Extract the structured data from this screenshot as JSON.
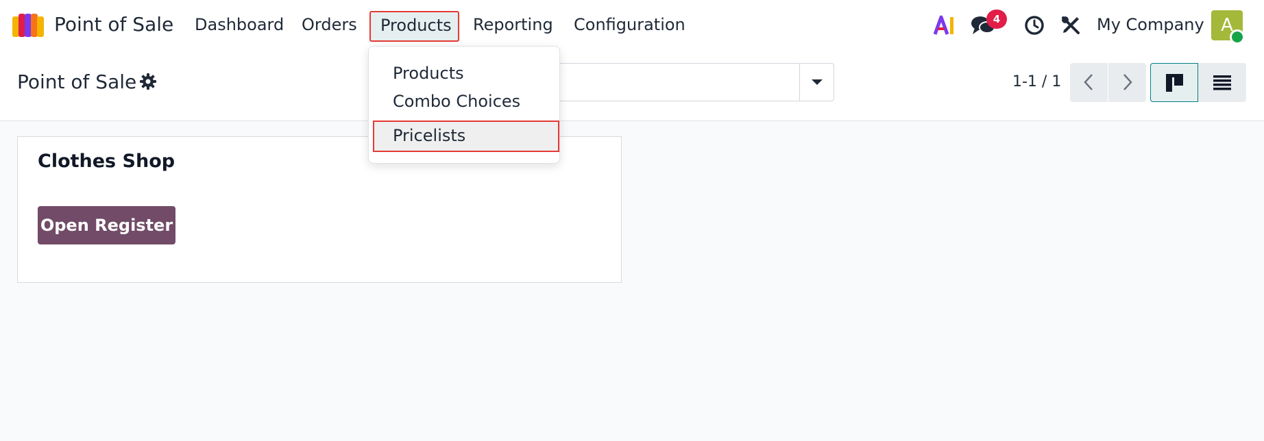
{
  "navbar": {
    "app_name": "Point of Sale",
    "menu": {
      "dashboard": "Dashboard",
      "orders": "Orders",
      "products": "Products",
      "reporting": "Reporting",
      "configuration": "Configuration"
    },
    "ai_icon": "ai-icon",
    "messages_badge": "4",
    "company": "My Company",
    "avatar_letter": "A"
  },
  "dropdown": {
    "items": [
      "Products",
      "Combo Choices",
      "Pricelists"
    ],
    "highlighted": "Pricelists"
  },
  "control_panel": {
    "title": "Point of Sale",
    "pager": "1-1 / 1"
  },
  "card": {
    "title": "Clothes Shop",
    "button_label": "Open Register"
  },
  "colors": {
    "brand": "#714b67",
    "accent": "#017e84",
    "badge": "#e11d48",
    "highlight_border": "#e53935"
  }
}
